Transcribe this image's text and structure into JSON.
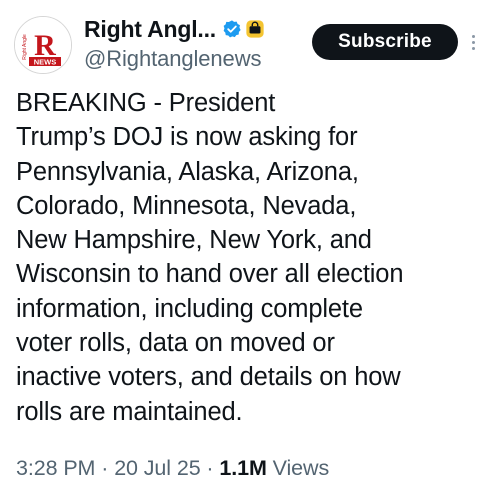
{
  "author": {
    "display_name": "Right Angl...",
    "handle": "@Rightanglenews",
    "avatar_text_top": "Right Angle",
    "avatar_letter": "R",
    "avatar_text_bottom": "NEWS",
    "verified_icon": "verified-check-icon",
    "affiliation_icon": "gold-badge-icon",
    "brand_color": "#c4161c"
  },
  "actions": {
    "subscribe_label": "Subscribe",
    "more_icon": "more-options-icon"
  },
  "post": {
    "text": "BREAKING - President\nTrump’s DOJ is now asking for\nPennsylvania, Alaska, Arizona,\nColorado, Minnesota, Nevada,\nNew Hampshire, New York, and\nWisconsin to hand over all election\ninformation, including complete\nvoter rolls, data on moved or\ninactive voters, and details on how\nrolls are maintained."
  },
  "meta": {
    "time": "3:28 PM",
    "separator": " · ",
    "date": "20 Jul 25",
    "views_count": "1.1M",
    "views_label": "Views"
  },
  "colors": {
    "text_primary": "#0f1419",
    "text_secondary": "#536471",
    "verified_blue": "#1d9bf0",
    "gold": "#f4c430",
    "button_bg": "#0f1419"
  }
}
